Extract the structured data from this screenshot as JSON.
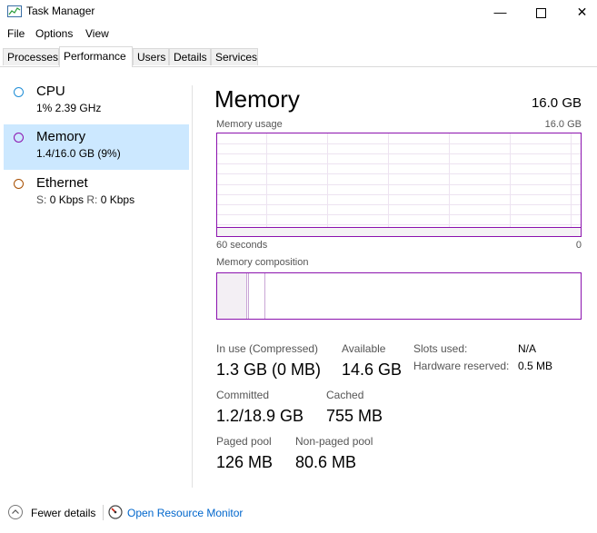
{
  "window": {
    "title": "Task Manager"
  },
  "menu": [
    "File",
    "Options",
    "View"
  ],
  "tabs": [
    "Processes",
    "Performance",
    "Users",
    "Details",
    "Services"
  ],
  "active_tab": "Performance",
  "sidebar": {
    "items": [
      {
        "name": "CPU",
        "sub": "1%  2.39 GHz",
        "color": "#1f8dd6",
        "selected": false
      },
      {
        "name": "Memory",
        "sub": "1.4/16.0 GB (9%)",
        "color": "#8b12ae",
        "selected": true
      },
      {
        "name": "Ethernet",
        "sub_s_label": "S:",
        "sub_s_value": "0 Kbps",
        "sub_r_label": "R:",
        "sub_r_value": "0 Kbps",
        "color": "#a74f01",
        "selected": false
      }
    ]
  },
  "main": {
    "title": "Memory",
    "total": "16.0 GB",
    "usage_graph": {
      "label": "Memory usage",
      "max": "16.0 GB",
      "time_left": "60 seconds",
      "time_right": "0",
      "level_fraction": 0.09
    },
    "composition": {
      "label": "Memory composition",
      "in_use_fraction": 0.081,
      "modified_fraction": 0.005,
      "standby_fraction": 0.047
    },
    "stats": {
      "in_use_label": "In use (Compressed)",
      "in_use_value": "1.3 GB (0 MB)",
      "available_label": "Available",
      "available_value": "14.6 GB",
      "committed_label": "Committed",
      "committed_value": "1.2/18.9 GB",
      "cached_label": "Cached",
      "cached_value": "755 MB",
      "paged_label": "Paged pool",
      "paged_value": "126 MB",
      "nonpaged_label": "Non-paged pool",
      "nonpaged_value": "80.6 MB"
    },
    "details": {
      "slots_label": "Slots used:",
      "slots_value": "N/A",
      "hw_label": "Hardware reserved:",
      "hw_value": "0.5 MB"
    }
  },
  "footer": {
    "fewer_details": "Fewer details",
    "open_resmon": "Open Resource Monitor"
  },
  "colors": {
    "memory_accent": "#8b12ae",
    "selection": "#cce8ff",
    "link": "#0066cc"
  }
}
